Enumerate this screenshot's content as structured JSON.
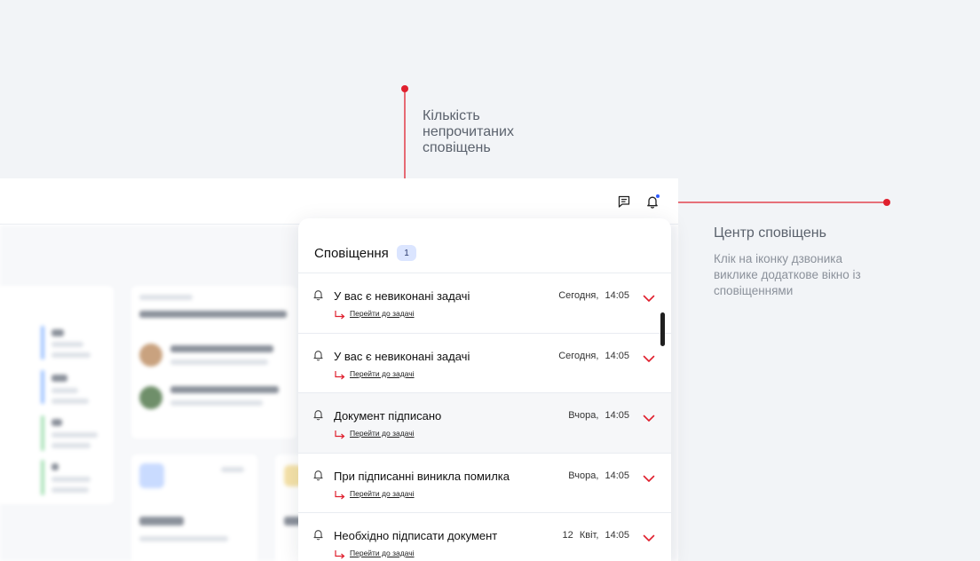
{
  "annotations": {
    "unread_count_lines": [
      "Кількість",
      "непрочитаних",
      "сповіщень"
    ],
    "notification_center_title": "Центр сповіщень",
    "notification_center_desc_lines": [
      "Клік на іконку дзвоника",
      "виклике додаткове вікно із",
      "сповіщеннями"
    ],
    "accent_color": "#e0202e"
  },
  "header": {
    "icons": [
      "chat-icon",
      "bell-icon"
    ],
    "unread_indicator_color": "#2e5bff"
  },
  "panel": {
    "title": "Сповіщення",
    "count": "1",
    "notifications": [
      {
        "title": "У вас є невиконані задачі",
        "date": "Сегодня,",
        "time": "14:05",
        "link": "Перейти до задачі"
      },
      {
        "title": "У вас є невиконані задачі",
        "date": "Сегодня,",
        "time": "14:05",
        "link": "Перейти до задачі"
      },
      {
        "title": "Документ підписано",
        "date": "Вчора,",
        "time": "14:05",
        "link": "Перейти до задачі"
      },
      {
        "title": "При підписанні виникла помилка",
        "date": "Вчора,",
        "time": "14:05",
        "link": "Перейти до задачі"
      },
      {
        "title": "Необхідно підписати документ",
        "date": "12 Квіт,",
        "time": "14:05",
        "link": "Перейти до задачі"
      }
    ]
  }
}
